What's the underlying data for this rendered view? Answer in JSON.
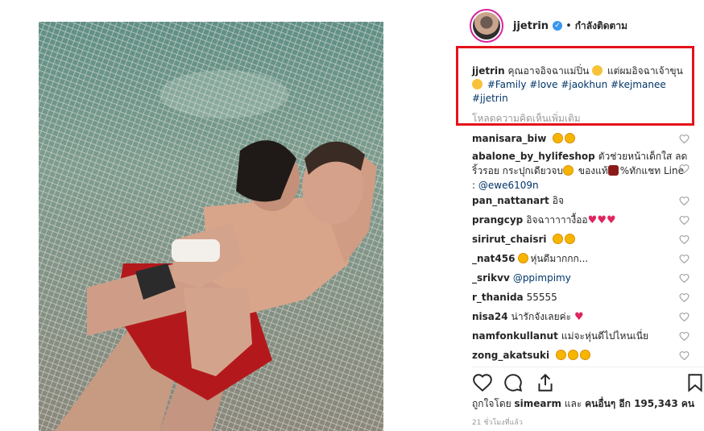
{
  "header": {
    "username": "jjetrin",
    "dot": "•",
    "follow_status": "กำลังติดตาม"
  },
  "caption": {
    "username": "jjetrin",
    "text_1": "คุณอาจอิจฉาแม่ปิ่น",
    "text_2": "แต่ผมอิจฉาเจ้าขุน",
    "hashtags": "#Family #love #jaokhun #kejmanee #jjetrin",
    "load_more": "โหลดความคิดเห็นเพิ่มเติม"
  },
  "comments": [
    {
      "user": "manisara_biw",
      "text": "",
      "emoji": [
        "star-eyes",
        "star-eyes"
      ]
    },
    {
      "user": "abalone_by_hylifeshop",
      "text": "ตัวช่วยหน้าเด็กใส ลดริ้วรอย กระปุกเดียวจบ",
      "text2": "ของแท้",
      "text3": "%ทักแชท Line :",
      "mention": "@ewe6109n"
    },
    {
      "user": "pan_nattanart",
      "text": "อิจ"
    },
    {
      "user": "prangcyp",
      "text": "อิจฉาาาาางื้ออ",
      "emoji": [
        "heart",
        "heart",
        "heart"
      ]
    },
    {
      "user": "sirirut_chaisri",
      "text": "",
      "emoji": [
        "star-eyes",
        "star-eyes"
      ]
    },
    {
      "user": "_nat456",
      "text": "หุ่นดีมากกก..."
    },
    {
      "user": "_srikvv",
      "text": "",
      "mention": "@ppimpimy"
    },
    {
      "user": "r_thanida",
      "text": "55555"
    },
    {
      "user": "nisa24",
      "text": "น่ารักจังเลยค่ะ",
      "emoji": [
        "heart"
      ]
    },
    {
      "user": "namfonkullanut",
      "text": "แม่จะหุ่นดีไปไหนเนี่ย"
    },
    {
      "user": "zong_akatsuki",
      "text": "",
      "emoji": [
        "star-eyes",
        "star-eyes",
        "star-eyes"
      ]
    }
  ],
  "likes": {
    "prefix": "ถูกใจโดย",
    "user": "simearm",
    "and": "และ",
    "others": "คนอื่นๆ อีก 195,343 คน"
  },
  "timestamp": "21 ชั่วโมงที่แล้ว",
  "icons": [
    "heart-icon",
    "comment-icon",
    "share-icon",
    "bookmark-icon"
  ],
  "colors": {
    "highlight_box": "#e3131b",
    "link": "#003569",
    "verified": "#3897f0",
    "muted": "#999999"
  }
}
